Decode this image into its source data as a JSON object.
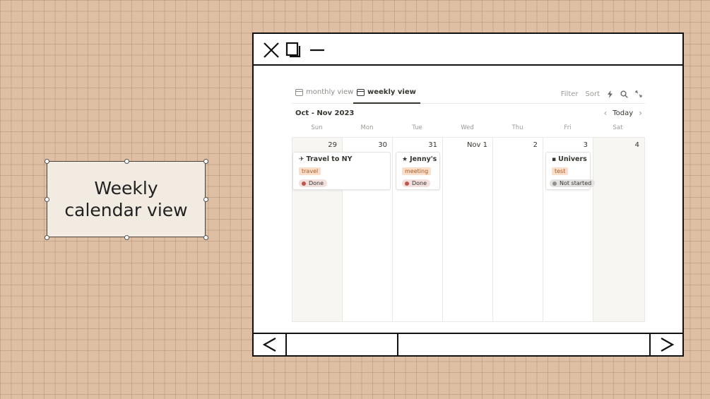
{
  "canvas_label": {
    "text": "Weekly\ncalendar view"
  },
  "calendar": {
    "tabs": [
      {
        "label": "monthly view",
        "icon": "table-icon",
        "active": false
      },
      {
        "label": "weekly view",
        "icon": "table-icon",
        "active": true
      }
    ],
    "toolbar": {
      "filter_label": "Filter",
      "sort_label": "Sort",
      "icons": [
        "lightning-icon",
        "search-icon",
        "expand-icon"
      ]
    },
    "range_title": "Oct - Nov 2023",
    "today_label": "Today",
    "weekdays": [
      "Sun",
      "Mon",
      "Tue",
      "Wed",
      "Thu",
      "Fri",
      "Sat"
    ],
    "days": [
      "29",
      "30",
      "31",
      "Nov 1",
      "2",
      "3",
      "4"
    ],
    "events": [
      {
        "title": "Travel to NY",
        "emoji": "✈",
        "tag": "travel",
        "status": "Done"
      },
      {
        "title": "Jenny's…",
        "emoji": "★",
        "tag": "meeting",
        "status": "Done"
      },
      {
        "title": "Univers…",
        "emoji": "▪",
        "tag": "test",
        "status": "Not started"
      }
    ]
  },
  "colors": {
    "background": "#dfbfa3",
    "done_dot": "#c4554d",
    "not_started_dot": "#91918e",
    "tag_bg": "#fadec9",
    "tag_text": "#a75c2a"
  }
}
